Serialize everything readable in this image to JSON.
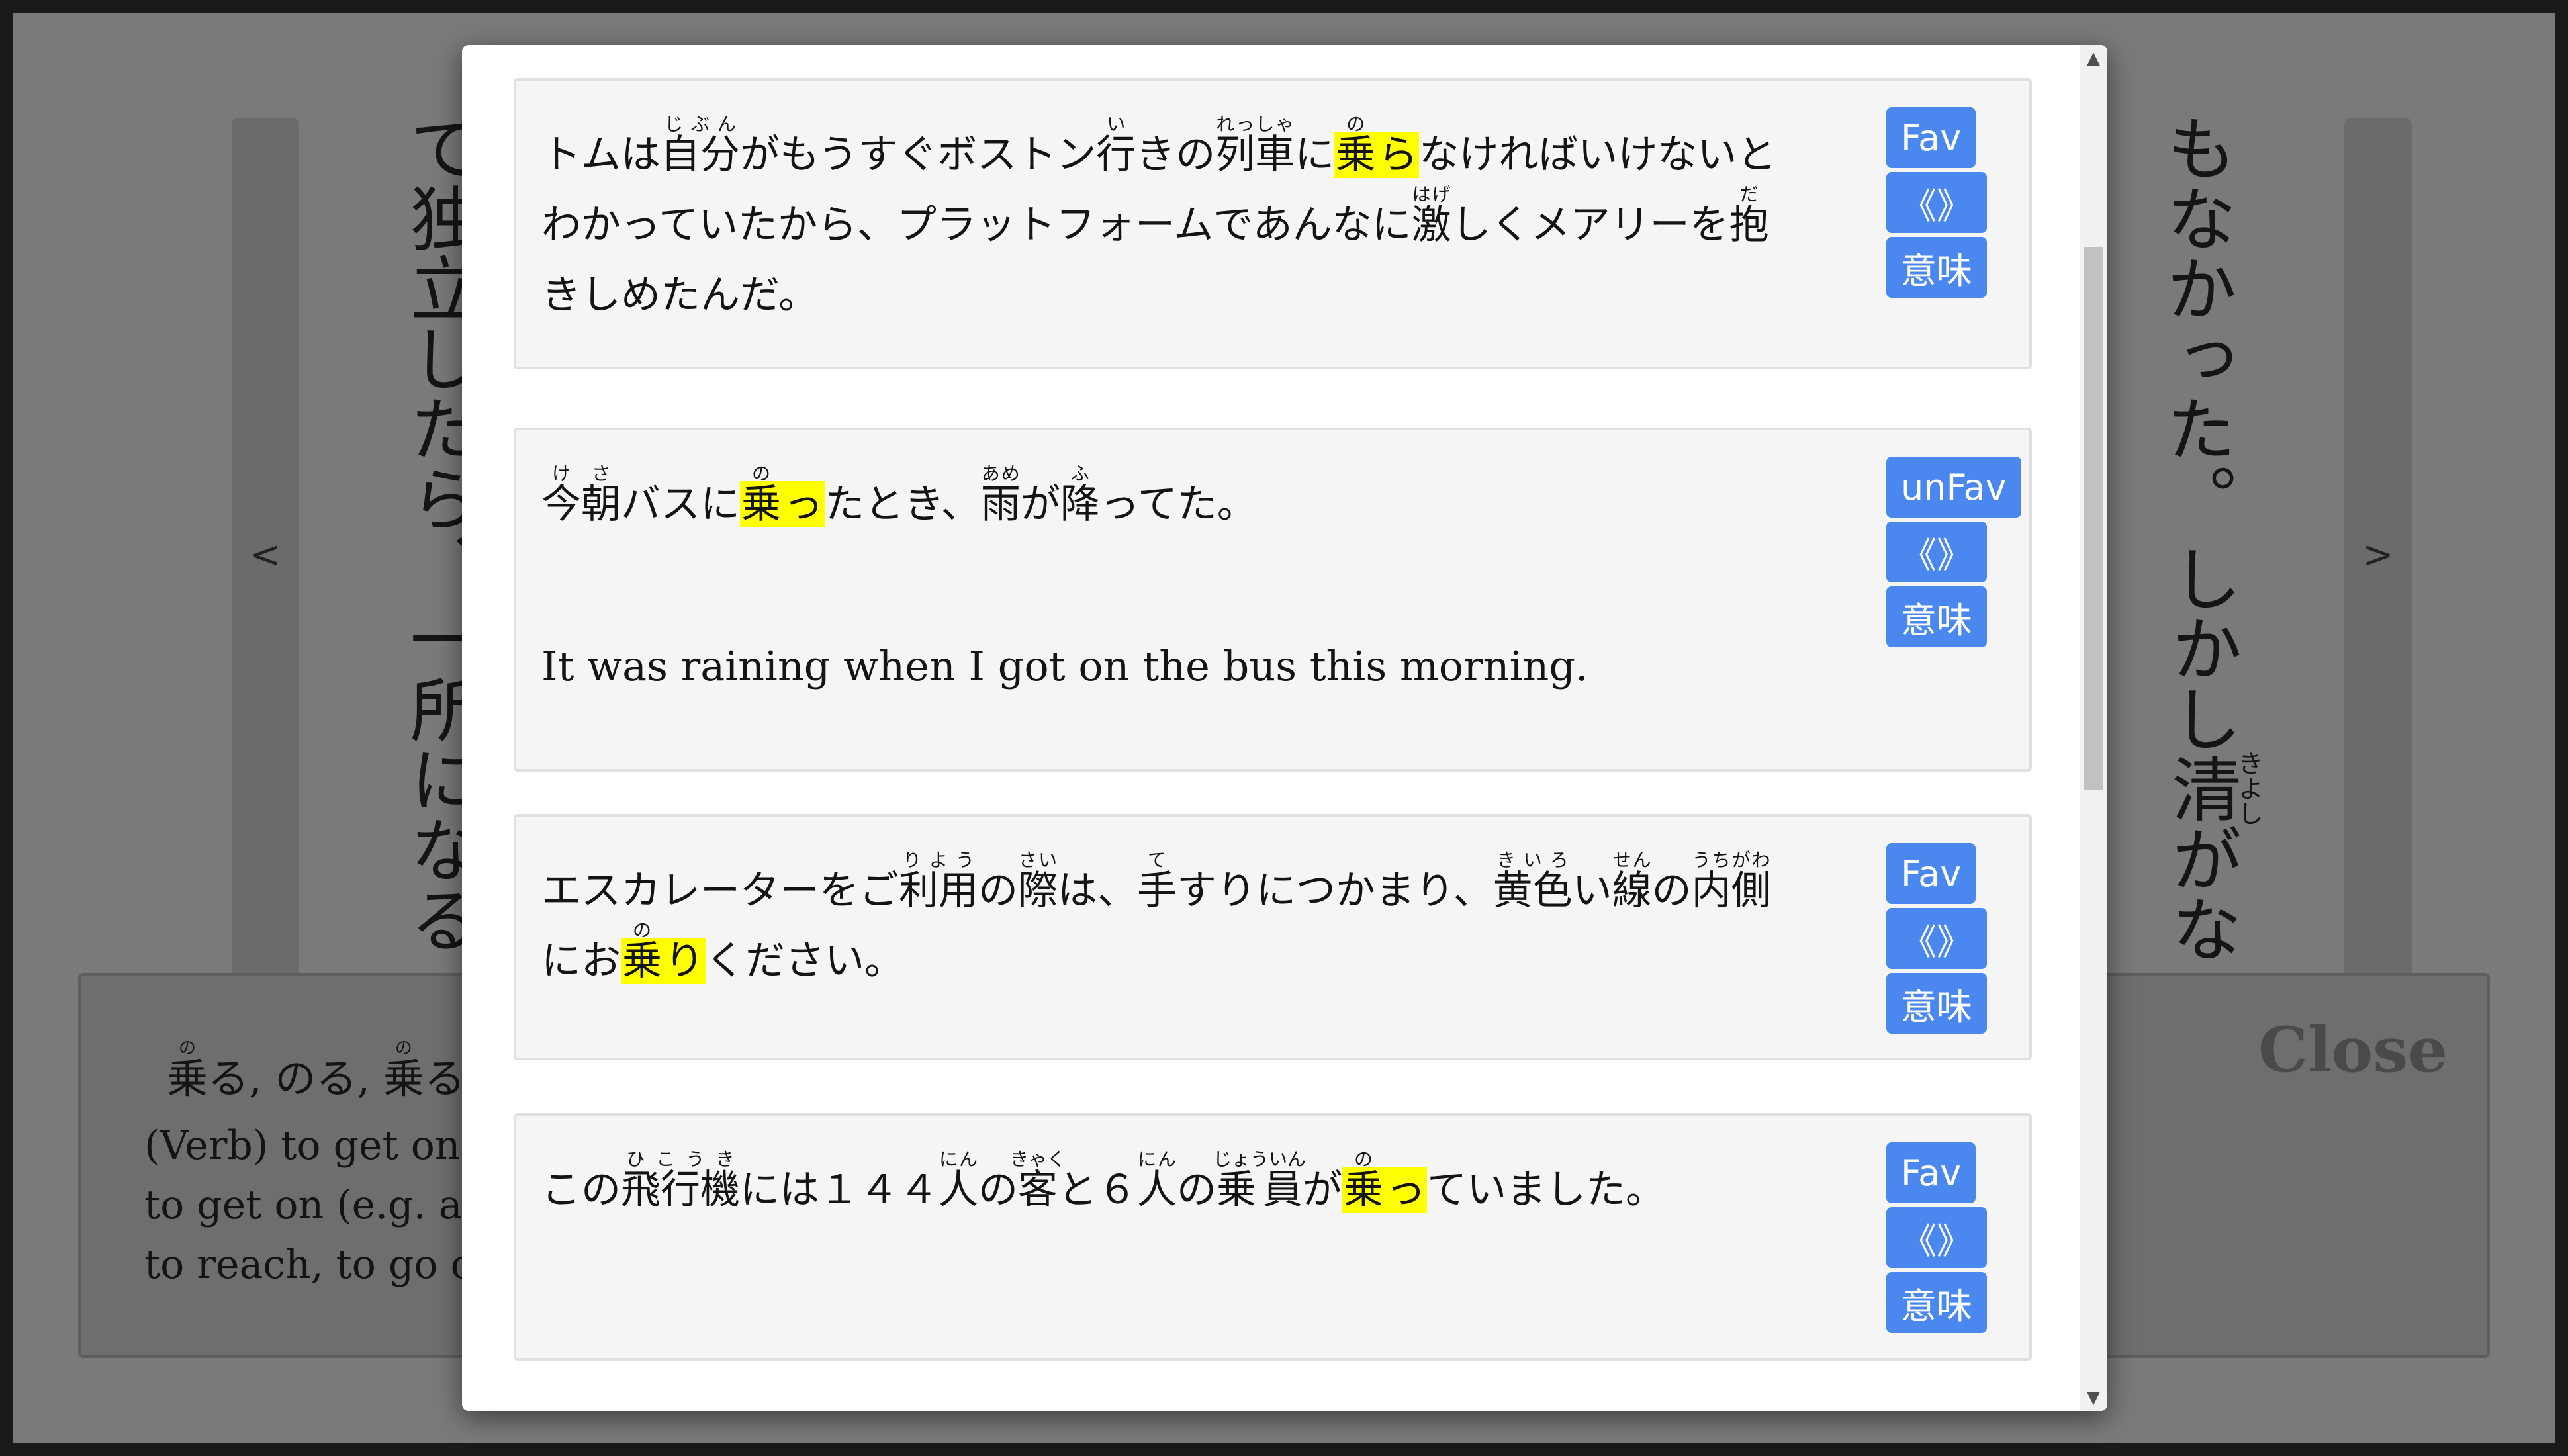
{
  "background": {
    "prev_label": "<",
    "next_label": ">",
    "left_column": [
      {
        "text": "て"
      },
      {
        "text": "独"
      },
      {
        "text": "立"
      },
      {
        "text": "し"
      },
      {
        "text": "た"
      },
      {
        "text": "ら"
      },
      {
        "text": "、"
      },
      {
        "text": "一"
      },
      {
        "text": "所"
      },
      {
        "text": "に"
      },
      {
        "text": "な"
      },
      {
        "text": "る"
      }
    ],
    "right_column_1": "もなかった。",
    "right_column_2": {
      "prefix": "しかし",
      "kanji": "清",
      "ruby": "きよし",
      "suffix": "がな"
    }
  },
  "dictionary": {
    "heading": [
      {
        "text": "乗",
        "ruby": "の"
      },
      {
        "text": "る, のる, "
      },
      {
        "text": "乗",
        "ruby": "の"
      },
      {
        "text": "る"
      }
    ],
    "definitions": [
      "(Verb) to get on (tra",
      "to get on (e.g. a foo",
      "to reach, to go over"
    ],
    "close_label": "Close"
  },
  "modal": {
    "scroll_up": "▲",
    "scroll_down": "▼",
    "cards": [
      {
        "fav_label": "Fav",
        "examples_label": "《》",
        "meaning_label": "意味",
        "translation": "",
        "tokens": [
          {
            "text": "トムは"
          },
          {
            "text": "自分",
            "ruby": "じぶん"
          },
          {
            "text": "がもうすぐボストン"
          },
          {
            "text": "行",
            "ruby": "い"
          },
          {
            "text": "きの"
          },
          {
            "text": "列車",
            "ruby": "れっしゃ"
          },
          {
            "text": "に"
          },
          {
            "text": "乗",
            "ruby": "の",
            "hl": true
          },
          {
            "text": "ら",
            "hl": true
          },
          {
            "text": "なければいけないとわかっていたから、プラットフォームであんなに"
          },
          {
            "text": "激",
            "ruby": "はげ"
          },
          {
            "text": "しくメアリーを"
          },
          {
            "text": "抱",
            "ruby": "だ"
          },
          {
            "text": "きしめたんだ。"
          }
        ]
      },
      {
        "fav_label": "unFav",
        "examples_label": "《》",
        "meaning_label": "意味",
        "translation": "It was raining when I got on the bus this morning.",
        "tokens": [
          {
            "text": "今朝",
            "ruby": "けさ"
          },
          {
            "text": "バスに"
          },
          {
            "text": "乗",
            "ruby": "の",
            "hl": true
          },
          {
            "text": "っ",
            "hl": true
          },
          {
            "text": "たとき、"
          },
          {
            "text": "雨",
            "ruby": "あめ"
          },
          {
            "text": "が"
          },
          {
            "text": "降",
            "ruby": "ふ"
          },
          {
            "text": "ってた。"
          }
        ]
      },
      {
        "fav_label": "Fav",
        "examples_label": "《》",
        "meaning_label": "意味",
        "translation": "",
        "tokens": [
          {
            "text": "エスカレーターをご"
          },
          {
            "text": "利用",
            "ruby": "りよう"
          },
          {
            "text": "の"
          },
          {
            "text": "際",
            "ruby": "さい"
          },
          {
            "text": "は、"
          },
          {
            "text": "手",
            "ruby": "て"
          },
          {
            "text": "すりにつかまり、"
          },
          {
            "text": "黄色",
            "ruby": "きいろ"
          },
          {
            "text": "い"
          },
          {
            "text": "線",
            "ruby": "せん"
          },
          {
            "text": "の"
          },
          {
            "text": "内側",
            "ruby": "うちがわ"
          },
          {
            "text": "にお"
          },
          {
            "text": "乗",
            "ruby": "の",
            "hl": true
          },
          {
            "text": "り",
            "hl": true
          },
          {
            "text": "ください。"
          }
        ]
      },
      {
        "fav_label": "Fav",
        "examples_label": "《》",
        "meaning_label": "意味",
        "translation": "",
        "tokens": [
          {
            "text": "この"
          },
          {
            "text": "飛行機",
            "ruby": "ひこうき"
          },
          {
            "text": "には１４４"
          },
          {
            "text": "人",
            "ruby": "にん"
          },
          {
            "text": "の"
          },
          {
            "text": "客",
            "ruby": "きゃく"
          },
          {
            "text": "と６"
          },
          {
            "text": "人",
            "ruby": "にん"
          },
          {
            "text": "の"
          },
          {
            "text": "乗員",
            "ruby": "じょういん"
          },
          {
            "text": "が"
          },
          {
            "text": "乗",
            "ruby": "の",
            "hl": true
          },
          {
            "text": "っ",
            "hl": true
          },
          {
            "text": "ていました。"
          }
        ]
      }
    ]
  }
}
